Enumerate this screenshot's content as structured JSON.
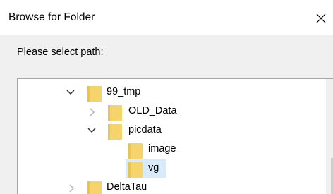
{
  "dialog": {
    "title": "Browse for Folder",
    "close_glyph": "✕",
    "prompt": "Please select path:"
  },
  "tree": {
    "items": [
      {
        "label": "99_tmp",
        "expanded": true,
        "icon": "folder-icon"
      },
      {
        "label": "OLD_Data",
        "expanded": false,
        "icon": "folder-icon"
      },
      {
        "label": "picdata",
        "expanded": true,
        "icon": "folder-icon"
      },
      {
        "label": "image",
        "icon": "folder-icon"
      },
      {
        "label": "vg",
        "selected": true,
        "icon": "folder-icon"
      },
      {
        "label": "DeltaTau",
        "expanded": false,
        "icon": "folder-icon"
      }
    ]
  },
  "colors": {
    "folder": "#f5d46c",
    "selection": "#d9ebfa",
    "dialog_bg": "#f0f0f0"
  }
}
